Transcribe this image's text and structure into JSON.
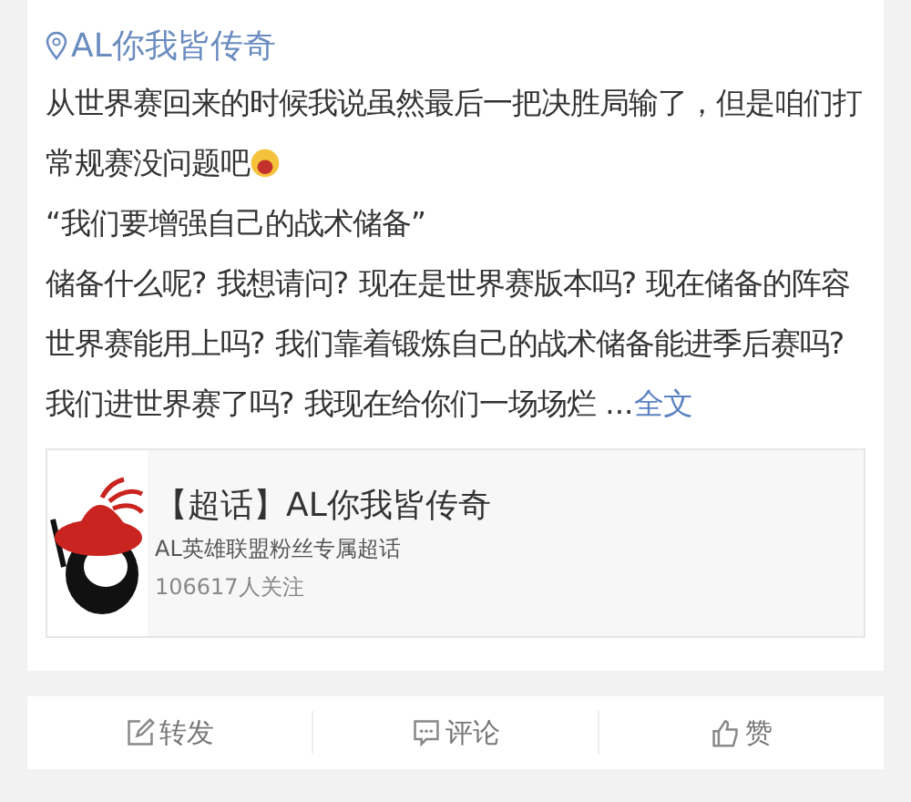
{
  "post": {
    "location": "AL你我皆传奇",
    "paragraphs": [
      {
        "kind": "emoji",
        "text": "从世界赛回来的时候我说虽然最后一把决胜局输了，但是咱们打常规赛没问题吧"
      },
      {
        "kind": "plain",
        "text": "“我们要增强自己的战术储备”"
      },
      {
        "kind": "more",
        "text": "储备什么呢? 我想请问? 现在是世界赛版本吗? 现在储备的阵容世界赛能用上吗? 我们靠着锻炼自己的战术储备能进季后赛吗? 我们进世界赛了吗? 我现在给你们一场场烂 ...",
        "link": "全文"
      }
    ],
    "topic_card": {
      "title": "【超话】AL你我皆传奇",
      "subtitle": "AL英雄联盟粉丝专属超话",
      "followers": "106617人关注"
    }
  },
  "actions": [
    {
      "kind": "repost",
      "label": "转发"
    },
    {
      "kind": "comment",
      "label": "评论"
    },
    {
      "kind": "like",
      "label": "赞"
    }
  ]
}
